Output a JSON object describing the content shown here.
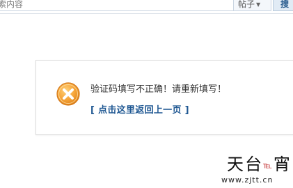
{
  "search": {
    "input_text": "索内容",
    "type_label": "帖子",
    "button_label": "搜"
  },
  "message": {
    "text": "验证码填写不正确！请重新填写！",
    "back_link": "[ 点击这里返回上一页 ]"
  },
  "icons": {
    "error_icon": "error-x-circle",
    "error_color": "#f39c2a"
  },
  "watermark": {
    "chars_prefix": "天台",
    "chars_mark": "℡",
    "chars_suffix": "宵",
    "url": "www.zjtt.cn"
  }
}
